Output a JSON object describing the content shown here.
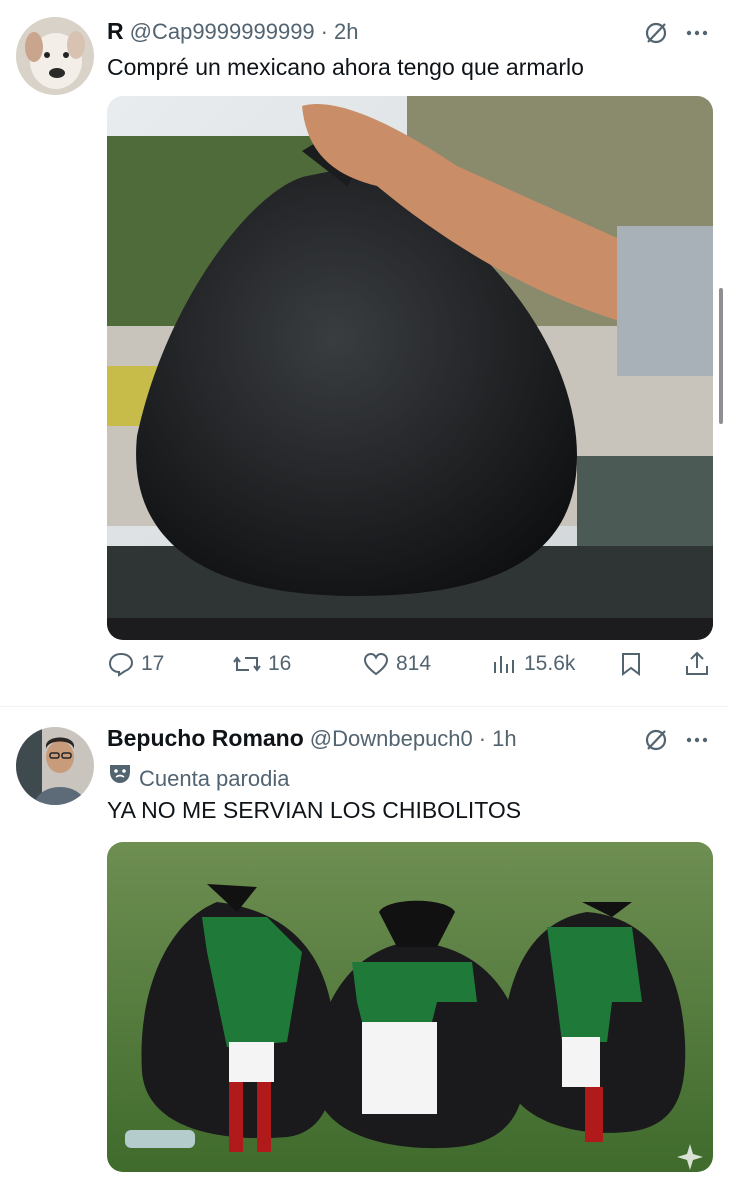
{
  "tweets": [
    {
      "display_name": "R",
      "handle": "@Cap9999999999",
      "time": "2h",
      "text": "Compré un mexicano ahora tengo que armarlo",
      "metrics": {
        "replies": "17",
        "reposts": "16",
        "likes": "814",
        "views": "15.6k"
      }
    },
    {
      "display_name": "Bepucho Romano",
      "handle": "@Downbepuch0",
      "time": "1h",
      "parody_label": "Cuenta parodia",
      "text": "YA NO ME SERVIAN LOS CHIBOLITOS"
    }
  ],
  "icons": {
    "grok": "grok-slash-icon",
    "more": "more-dots-icon",
    "reply": "reply-bubble-icon",
    "repost": "repost-arrows-icon",
    "like": "heart-icon",
    "views": "bar-chart-icon",
    "bookmark": "bookmark-icon",
    "share": "share-upload-icon",
    "parody": "theater-mask-icon"
  },
  "colors": {
    "text": "#0f1419",
    "muted": "#536471",
    "divider": "#eff3f4"
  }
}
